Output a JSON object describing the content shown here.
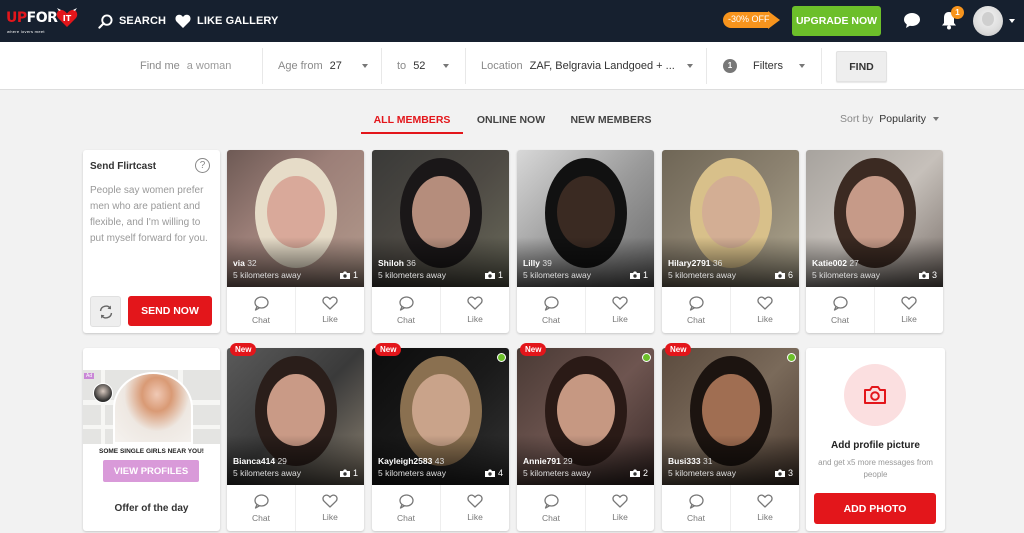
{
  "header": {
    "logo": {
      "part1": "UP",
      "part2": "FOR",
      "part3": "IT",
      "tagline": "where lovers meet"
    },
    "nav": [
      {
        "label": "SEARCH",
        "icon": "search-icon"
      },
      {
        "label": "LIKE GALLERY",
        "icon": "heart-icon"
      }
    ],
    "promo_label": "-30% OFF",
    "upgrade_label": "UPGRADE NOW",
    "notification_count": "1"
  },
  "search": {
    "find_me_label": "Find me",
    "find_me_value": "a woman",
    "age_from_label": "Age from",
    "age_from_value": "27",
    "age_to_label": "to",
    "age_to_value": "52",
    "location_label": "Location",
    "location_value": "ZAF, Belgravia Landgoed + ...",
    "filters_count": "1",
    "filters_label": "Filters",
    "find_label": "FIND"
  },
  "tabs": [
    {
      "label": "ALL MEMBERS",
      "active": true
    },
    {
      "label": "ONLINE NOW",
      "active": false
    },
    {
      "label": "NEW MEMBERS",
      "active": false
    }
  ],
  "sort": {
    "label": "Sort by",
    "value": "Popularity"
  },
  "flirtcast": {
    "title": "Send Flirtcast",
    "help": "?",
    "message": "People say women prefer men who are patient and flexible, and I'm willing to put myself forward for you.",
    "send_label": "SEND NOW"
  },
  "ad": {
    "tag": "Ad",
    "headline": "SOME SINGLE GIRLS NEAR YOU!",
    "button_label": "VIEW PROFILES",
    "offer": "Offer of the day"
  },
  "add_photo": {
    "title": "Add profile picture",
    "subtitle": "and get x5 more messages from people",
    "button_label": "ADD PHOTO"
  },
  "actions": {
    "chat": "Chat",
    "like": "Like"
  },
  "new_badge": "New",
  "members": [
    {
      "name": "via",
      "age": "32",
      "distance": "5 kilometers away",
      "photos": "1",
      "new": false,
      "online": false
    },
    {
      "name": "Shiloh",
      "age": "36",
      "distance": "5 kilometers away",
      "photos": "1",
      "new": false,
      "online": false
    },
    {
      "name": "Lilly",
      "age": "39",
      "distance": "5 kilometers away",
      "photos": "1",
      "new": false,
      "online": false
    },
    {
      "name": "Hilary2791",
      "age": "36",
      "distance": "5 kilometers away",
      "photos": "6",
      "new": false,
      "online": false
    },
    {
      "name": "Katie002",
      "age": "27",
      "distance": "5 kilometers away",
      "photos": "3",
      "new": false,
      "online": false
    },
    {
      "name": "Bianca414",
      "age": "29",
      "distance": "5 kilometers away",
      "photos": "1",
      "new": true,
      "online": false
    },
    {
      "name": "Kayleigh2583",
      "age": "43",
      "distance": "5 kilometers away",
      "photos": "4",
      "new": true,
      "online": true
    },
    {
      "name": "Annie791",
      "age": "29",
      "distance": "5 kilometers away",
      "photos": "2",
      "new": true,
      "online": true
    },
    {
      "name": "Busi333",
      "age": "31",
      "distance": "5 kilometers away",
      "photos": "3",
      "new": true,
      "online": true
    }
  ],
  "colors": {
    "brand_red": "#e3161b",
    "upgrade_green": "#6cbf2a",
    "promo_orange": "#f7941d",
    "nav_bg": "#16202f"
  }
}
